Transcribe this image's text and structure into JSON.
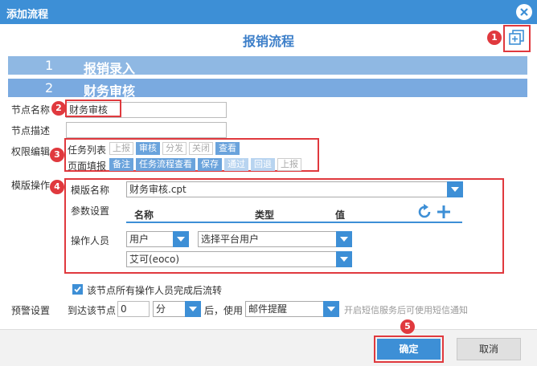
{
  "dialog": {
    "title": "添加流程",
    "heading": "报销流程"
  },
  "badges": [
    "1",
    "2",
    "3",
    "4",
    "5"
  ],
  "steps": [
    {
      "num": "1",
      "label": "报销录入"
    },
    {
      "num": "2",
      "label": "财务审核"
    }
  ],
  "form": {
    "node_name_label": "节点名称",
    "node_name_value": "财务审核",
    "node_desc_label": "节点描述",
    "node_desc_value": "",
    "perm_label": "权限编辑",
    "task_list_label": "任务列表",
    "task_list_tags": [
      {
        "label": "上报",
        "state": "off"
      },
      {
        "label": "审核",
        "state": "on"
      },
      {
        "label": "分发",
        "state": "off"
      },
      {
        "label": "关闭",
        "state": "off"
      },
      {
        "label": "查看",
        "state": "on"
      }
    ],
    "page_fill_label": "页面填报",
    "page_fill_tags": [
      {
        "label": "备注",
        "state": "on"
      },
      {
        "label": "任务流程查看",
        "state": "on"
      },
      {
        "label": "保存",
        "state": "on"
      },
      {
        "label": "通过",
        "state": "pale"
      },
      {
        "label": "回退",
        "state": "pale"
      },
      {
        "label": "上报",
        "state": "off"
      }
    ],
    "template_op_label": "模版操作",
    "template_name_label": "模版名称",
    "template_name_value": "财务审核.cpt",
    "param_label": "参数设置",
    "param_cols": [
      "名称",
      "类型",
      "值"
    ],
    "operator_label": "操作人员",
    "operator_type": "用户",
    "operator_platform": "选择平台用户",
    "operator_user": "艾可(eoco)",
    "flow_checkbox_label": "该节点所有操作人员完成后流转",
    "warn_label": "预警设置",
    "warn_prefix": "到达该节点",
    "warn_value": "0",
    "warn_unit": "分",
    "warn_mid": "后，使用",
    "warn_method": "邮件提醒",
    "warn_hint": "开启短信服务后可使用短信通知"
  },
  "footer": {
    "ok_label": "确定",
    "cancel_label": "取消"
  },
  "colors": {
    "accent": "#3d8fd6",
    "highlight": "#e0393e"
  }
}
